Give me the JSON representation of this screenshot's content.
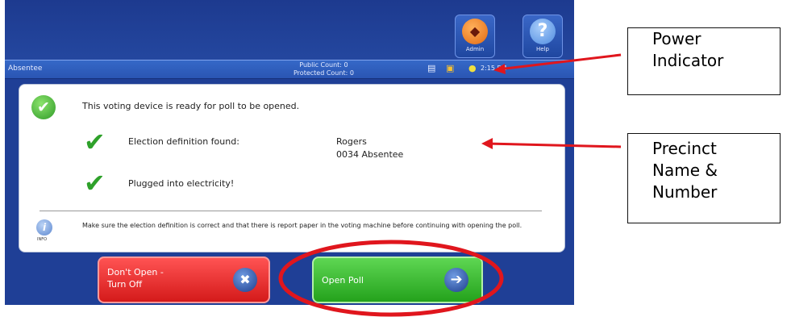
{
  "device": {
    "toolbar": {
      "admin_label": "Admin",
      "help_label": "Help",
      "help_glyph": "?",
      "admin_icon": "admin-badge-icon"
    },
    "status": {
      "mode": "Absentee",
      "public_count": "Public Count: 0",
      "protected_count": "Protected Count: 0",
      "time": "2:15 PM",
      "icons": [
        "printer-icon",
        "disk-icon",
        "power-plug-icon"
      ]
    },
    "panel": {
      "ready_message": "This voting device is ready for poll to be opened.",
      "definition_label": "Election definition found:",
      "precinct_name": "Rogers",
      "precinct_number": "0034 Absentee",
      "plugged_message": "Plugged into electricity!",
      "info_tag": "INFO",
      "info_text": "Make sure the election definition is correct and that there is report paper in the voting machine before continuing with opening the poll."
    },
    "buttons": {
      "dont_open": "Don't Open -\nTurn Off",
      "open_poll": "Open Poll"
    }
  },
  "annotations": {
    "power_indicator": "Power\nIndicator",
    "precinct": "Precinct\nName &\nNumber"
  },
  "colors": {
    "screen_blue": "#1f3f96",
    "annotation_red": "#e0161d",
    "open_green": "#24a21c",
    "off_red": "#d41a1a"
  }
}
